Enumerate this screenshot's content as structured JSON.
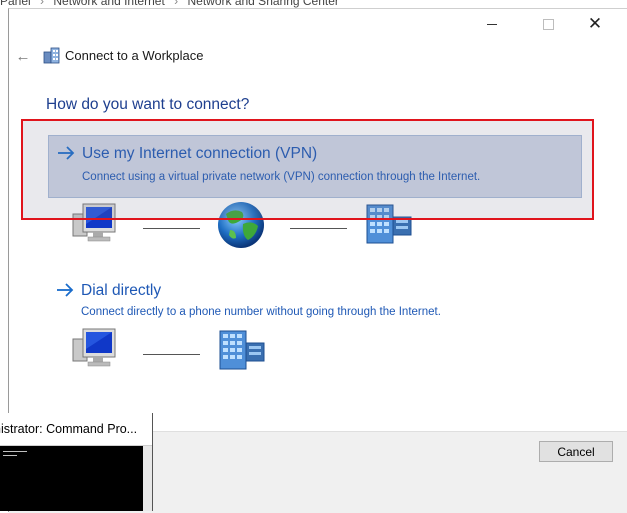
{
  "background": {
    "breadcrumb": [
      "Panel",
      "Network and Internet",
      "Network and Sharing Center"
    ],
    "separator": "›"
  },
  "window": {
    "title": "Connect to a Workplace",
    "minimize_icon": "minimize-icon",
    "maximize_icon": "maximize-icon",
    "close_glyph": "✕",
    "back_glyph": "←"
  },
  "main": {
    "heading": "How do you want to connect?",
    "options": [
      {
        "title": "Use my Internet connection (VPN)",
        "description": "Connect using a virtual private network (VPN) connection through the Internet."
      },
      {
        "title": "Dial directly",
        "description": "Connect directly to a phone number without going through the Internet."
      }
    ]
  },
  "footer": {
    "cancel_label": "Cancel"
  },
  "cmd_window": {
    "title": "nistrator: Command Pro..."
  },
  "colors": {
    "accent": "#1e58b5",
    "heading": "#1e3f8f",
    "selected_option_bg": "#cfd6e6",
    "highlight": "#e0141c"
  }
}
